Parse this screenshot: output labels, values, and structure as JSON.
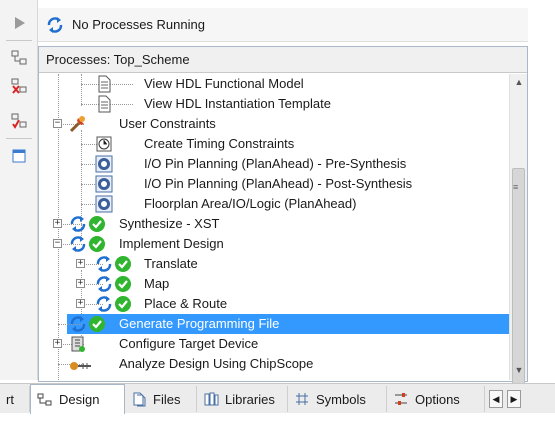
{
  "status": {
    "text": "No Processes Running"
  },
  "panel": {
    "title": "Processes: Top_Scheme"
  },
  "tree": [
    {
      "label": "View HDL Functional Model",
      "icon": "document-icon",
      "level": 3
    },
    {
      "label": "View HDL Instantiation Template",
      "icon": "document-icon",
      "level": 3
    },
    {
      "label": "User Constraints",
      "icon": "constraints-tool-icon",
      "level": 1,
      "expander": "minus"
    },
    {
      "label": "Create Timing Constraints",
      "icon": "timing-clock-icon",
      "level": 2
    },
    {
      "label": "I/O Pin Planning (PlanAhead) - Pre-Synthesis",
      "icon": "planahead-icon",
      "level": 2
    },
    {
      "label": "I/O Pin Planning (PlanAhead) - Post-Synthesis",
      "icon": "planahead-icon",
      "level": 2
    },
    {
      "label": "Floorplan Area/IO/Logic (PlanAhead)",
      "icon": "planahead-icon",
      "level": 2
    },
    {
      "label": "Synthesize - XST",
      "icon": "process-ok-icon",
      "level": 1,
      "expander": "plus"
    },
    {
      "label": "Implement Design",
      "icon": "process-ok-icon",
      "level": 1,
      "expander": "minus"
    },
    {
      "label": "Translate",
      "icon": "process-ok-icon",
      "level": 2,
      "expander": "plus"
    },
    {
      "label": "Map",
      "icon": "process-ok-icon",
      "level": 2,
      "expander": "plus"
    },
    {
      "label": "Place & Route",
      "icon": "process-ok-icon",
      "level": 2,
      "expander": "plus"
    },
    {
      "label": "Generate Programming File",
      "icon": "process-ok-icon",
      "level": 1,
      "selected": true
    },
    {
      "label": "Configure Target Device",
      "icon": "device-config-icon",
      "level": 1,
      "expander": "plus"
    },
    {
      "label": "Analyze Design Using ChipScope",
      "icon": "chipscope-probe-icon",
      "level": 1
    }
  ],
  "tabs": [
    {
      "label": "rt",
      "icon": ""
    },
    {
      "label": "Design",
      "icon": "design-hierarchy-icon",
      "active": true
    },
    {
      "label": "Files",
      "icon": "files-icon"
    },
    {
      "label": "Libraries",
      "icon": "libraries-icon"
    },
    {
      "label": "Symbols",
      "icon": "symbols-icon"
    },
    {
      "label": "Options",
      "icon": "options-icon"
    }
  ],
  "colors": {
    "selection": "#3399ff",
    "ok_green": "#2fb52f",
    "refresh_blue": "#1f6fd0"
  }
}
